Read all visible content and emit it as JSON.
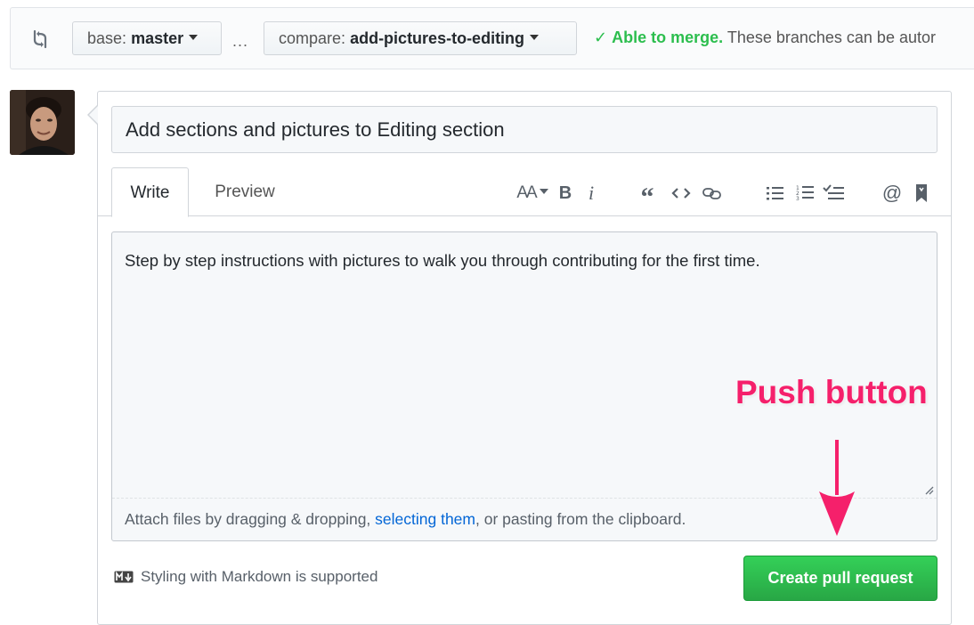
{
  "range": {
    "base_label": "base:",
    "base_branch": "master",
    "separator": "...",
    "compare_label": "compare:",
    "compare_branch": "add-pictures-to-editing",
    "merge_check": "✓",
    "merge_ok": "Able to merge.",
    "merge_note": "These branches can be autor"
  },
  "pr": {
    "title_value": "Add sections and pictures to Editing section",
    "tabs": [
      {
        "label": "Write"
      },
      {
        "label": "Preview"
      }
    ],
    "toolbar": {
      "text_size": "AA",
      "bold": "B",
      "italic": "i",
      "quote": "“",
      "mention": "@"
    },
    "body_text": "Step by step instructions with pictures to walk you through contributing for the first time.",
    "attach": {
      "before": "Attach files by dragging & dropping, ",
      "link": "selecting them",
      "after": ", or pasting from the clipboard."
    },
    "markdown_note": "Styling with Markdown is supported",
    "submit_label": "Create pull request"
  },
  "annotation": {
    "label": "Push button",
    "color": "#f5206b"
  },
  "colors": {
    "merge_green": "#2cbe4e",
    "button_green": "#28a745",
    "link_blue": "#0366d6"
  }
}
